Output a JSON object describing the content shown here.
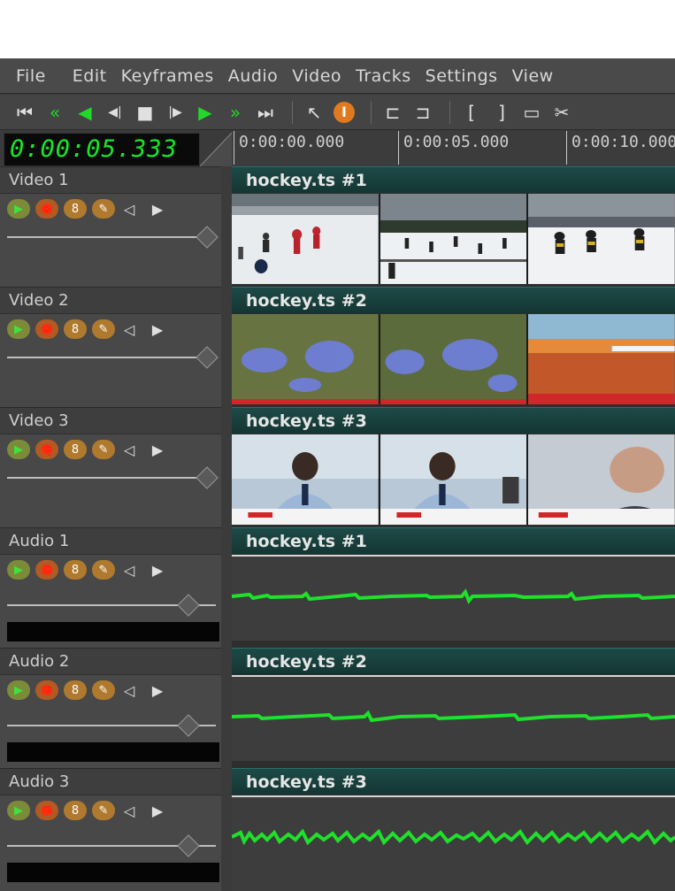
{
  "menubar": {
    "items": [
      "File",
      "Edit",
      "Keyframes",
      "Audio",
      "Video",
      "Tracks",
      "Settings",
      "View"
    ]
  },
  "toolbar": {
    "buttons": [
      {
        "icon": "skip-start-icon",
        "glyph": "⏮"
      },
      {
        "icon": "fast-rewind-icon",
        "glyph": "«"
      },
      {
        "icon": "rewind-icon",
        "glyph": "◀"
      },
      {
        "icon": "step-back-icon",
        "glyph": "◀|"
      },
      {
        "icon": "stop-icon",
        "glyph": "■"
      },
      {
        "icon": "step-forward-icon",
        "glyph": "|▶"
      },
      {
        "icon": "play-icon",
        "glyph": "▶"
      },
      {
        "icon": "fast-forward-icon",
        "glyph": "»"
      },
      {
        "icon": "skip-end-icon",
        "glyph": "⏭"
      },
      {
        "icon": "pointer-icon",
        "glyph": "↖"
      },
      {
        "icon": "text-cursor-icon",
        "glyph": "I"
      },
      {
        "icon": "link-icon",
        "glyph": "⊏"
      },
      {
        "icon": "unlink-icon",
        "glyph": "⊐"
      },
      {
        "icon": "mark-in-icon",
        "glyph": "["
      },
      {
        "icon": "mark-out-icon",
        "glyph": "]"
      },
      {
        "icon": "clip-icon",
        "glyph": "▭"
      },
      {
        "icon": "scissors-icon",
        "glyph": "✂"
      }
    ]
  },
  "timecode": "0:00:05.333",
  "ruler": {
    "labels": [
      "0:00:00.000",
      "0:00:05.000",
      "0:00:10.000"
    ]
  },
  "tracks": [
    {
      "name": "Video 1",
      "kind": "video",
      "clip": "hockey.ts #1"
    },
    {
      "name": "Video 2",
      "kind": "video",
      "clip": "hockey.ts #2"
    },
    {
      "name": "Video 3",
      "kind": "video",
      "clip": "hockey.ts #3"
    },
    {
      "name": "Audio 1",
      "kind": "audio",
      "clip": "hockey.ts #1"
    },
    {
      "name": "Audio 2",
      "kind": "audio",
      "clip": "hockey.ts #2"
    },
    {
      "name": "Audio 3",
      "kind": "audio",
      "clip": "hockey.ts #3"
    }
  ],
  "colors": {
    "timecode": "#17e82a",
    "clip_header": "#1d4a47",
    "waveform": "#1fe02a",
    "record": "#ff2a10"
  }
}
